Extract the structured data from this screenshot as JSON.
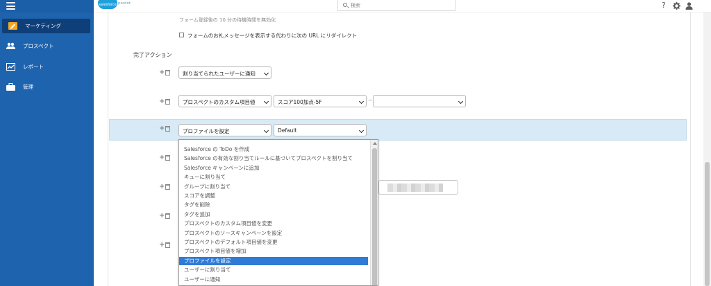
{
  "app": {
    "logo_text": "salesforce",
    "logo_sub": "pardot",
    "search_placeholder": "検索",
    "help_icon": "?",
    "settings_icon": "gear-icon",
    "user_icon": "user-icon"
  },
  "sidebar": {
    "items": [
      {
        "label": "マーケティング",
        "icon": "pencil-icon",
        "active": true
      },
      {
        "label": "プロスペクト",
        "icon": "users-icon",
        "active": false
      },
      {
        "label": "レポート",
        "icon": "chart-icon",
        "active": false
      },
      {
        "label": "管理",
        "icon": "briefcase-icon",
        "active": false
      }
    ]
  },
  "form": {
    "top_note": "フォーム登録後の 10 分の待機時間を無効化",
    "redirect_checkbox_label": "フォームのお礼メッセージを表示する代わりに次の URL にリダイレクト",
    "completion_actions_heading": "完了アクション",
    "action1_value": "割り当てられたユーザーに通知",
    "action2_value": "プロスペクトのカスタム項目値",
    "action2_field": "スコア100加点-5F",
    "action2_sep": "~",
    "action2_third": "",
    "action3_value": "プロファイルを設定",
    "action3_profile": "Default"
  },
  "dropdown": {
    "options": [
      "Salesforce の ToDo を作成",
      "Salesforce の有効な割り当てルールに基づいてプロスペクトを割り当て",
      "Salesforce キャンペーンに追加",
      "キューに割り当て",
      "グループに割り当て",
      "スコアを調整",
      "タグを削除",
      "タグを追加",
      "プロスペクトのカスタム項目値を変更",
      "プロスペクトのソースキャンペーンを設定",
      "プロスペクトのデフォルト項目値を変更",
      "プロスペクト項目値を増加",
      "プロファイルを設定",
      "ユーザーに割り当て",
      "ユーザーに通知"
    ],
    "selected_index": 12
  },
  "colors": {
    "sidebar_bg": "#1e63ae",
    "sidebar_active": "#0f3f78",
    "highlight_row": "#d8eaf6",
    "selected_option": "#2f7bd6"
  }
}
